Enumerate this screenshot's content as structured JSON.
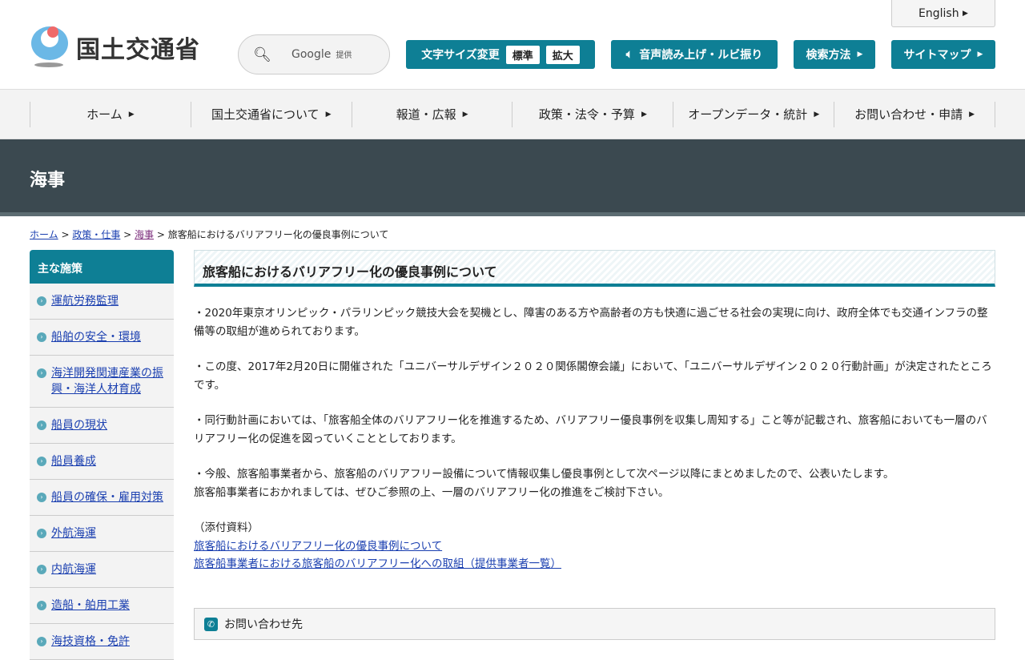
{
  "header": {
    "logo_text": "国土交通省",
    "search_brand": "Google",
    "search_provided": "提供",
    "font_size_label": "文字サイズ変更",
    "font_standard": "標準",
    "font_large": "拡大",
    "voice": "音声読み上げ・ルビ振り",
    "search_method": "検索方法",
    "sitemap": "サイトマップ",
    "english": "English"
  },
  "nav": [
    "ホーム",
    "国土交通省について",
    "報道・広報",
    "政策・法令・予算",
    "オープンデータ・統計",
    "お問い合わせ・申請"
  ],
  "banner": "海事",
  "breadcrumb": {
    "items": [
      "ホーム",
      "政策・仕事",
      "海事"
    ],
    "current": "旅客船におけるバリアフリー化の優良事例について"
  },
  "sidebar": {
    "title": "主な施策",
    "items": [
      "運航労務監理",
      "船舶の安全・環境",
      "海洋開発関連産業の振興・海洋人材育成",
      "船員の現状",
      "船員養成",
      "船員の確保・雇用対策",
      "外航海運",
      "内航海運",
      "造船・舶用工業",
      "海技資格・免許"
    ]
  },
  "main": {
    "title": "旅客船におけるバリアフリー化の優良事例について",
    "paragraphs": [
      "・2020年東京オリンピック・パラリンピック競技大会を契機とし、障害のある方や高齢者の方も快適に過ごせる社会の実現に向け、政府全体でも交通インフラの整備等の取組が進められております。",
      "・この度、2017年2月20日に開催された「ユニバーサルデザイン２０２０関係閣僚会議」において、「ユニバーサルデザイン２０２０行動計画」が決定されたところです。",
      "・同行動計画においては、「旅客船全体のバリアフリー化を推進するため、バリアフリー優良事例を収集し周知する」こと等が記載され、旅客船においても一層のバリアフリー化の促進を図っていくこととしております。"
    ],
    "p4a": "・今般、旅客船事業者から、旅客船のバリアフリー設備について情報収集し優良事例として次ページ以降にまとめましたので、公表いたします。",
    "p4b": "旅客船事業者におかれましては、ぜひご参照の上、一層のバリアフリー化の推進をご検討下さい。",
    "attach_label": "（添付資料）",
    "links": [
      "旅客船におけるバリアフリー化の優良事例について",
      "旅客船事業者における旅客船のバリアフリー化への取組（提供事業者一覧）"
    ],
    "contact": "お問い合わせ先"
  }
}
